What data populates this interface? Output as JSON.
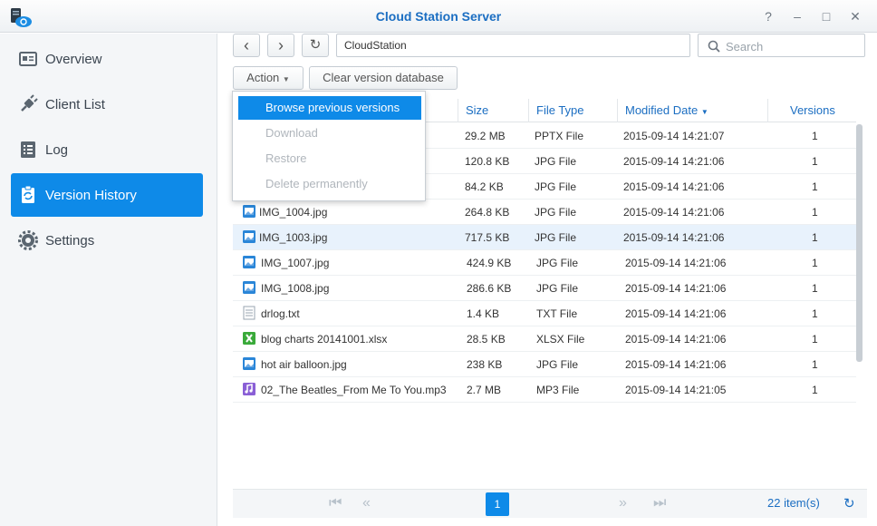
{
  "window": {
    "title": "Cloud Station Server",
    "controls": [
      "?",
      "–",
      "□",
      "✕"
    ]
  },
  "sidebar": {
    "items": [
      {
        "label": "Overview",
        "icon": "overview-icon"
      },
      {
        "label": "Client List",
        "icon": "plug-icon"
      },
      {
        "label": "Log",
        "icon": "log-icon"
      },
      {
        "label": "Version History",
        "icon": "version-history-icon",
        "active": true
      },
      {
        "label": "Settings",
        "icon": "gear-icon"
      }
    ]
  },
  "toolbar": {
    "back": "‹",
    "forward": "›",
    "refresh": "↻",
    "path": "CloudStation",
    "search_placeholder": "Search",
    "action_label": "Action",
    "clear_label": "Clear version database"
  },
  "menu": {
    "items": [
      "Browse previous versions",
      "Download",
      "Restore",
      "Delete permanently"
    ]
  },
  "table": {
    "headers": {
      "size": "Size",
      "type": "File Type",
      "modified": "Modified Date",
      "versions": "Versions"
    },
    "rows": [
      {
        "name": "",
        "size": "29.2 MB",
        "type": "PPTX File",
        "date": "2015-09-14 14:21:07",
        "versions": "1",
        "icon": "pptx"
      },
      {
        "name": "",
        "size": "120.8 KB",
        "type": "JPG File",
        "date": "2015-09-14 14:21:06",
        "versions": "1",
        "icon": "jpg"
      },
      {
        "name": "",
        "size": "84.2 KB",
        "type": "JPG File",
        "date": "2015-09-14 14:21:06",
        "versions": "1",
        "icon": "jpg"
      },
      {
        "name": "IMG_1004.jpg",
        "size": "264.8 KB",
        "type": "JPG File",
        "date": "2015-09-14 14:21:06",
        "versions": "1",
        "icon": "jpg"
      },
      {
        "name": "IMG_1003.jpg",
        "size": "717.5 KB",
        "type": "JPG File",
        "date": "2015-09-14 14:21:06",
        "versions": "1",
        "icon": "jpg",
        "selected": true
      },
      {
        "name": "IMG_1007.jpg",
        "size": "424.9 KB",
        "type": "JPG File",
        "date": "2015-09-14 14:21:06",
        "versions": "1",
        "icon": "jpg"
      },
      {
        "name": "IMG_1008.jpg",
        "size": "286.6 KB",
        "type": "JPG File",
        "date": "2015-09-14 14:21:06",
        "versions": "1",
        "icon": "jpg"
      },
      {
        "name": "drlog.txt",
        "size": "1.4 KB",
        "type": "TXT File",
        "date": "2015-09-14 14:21:06",
        "versions": "1",
        "icon": "txt"
      },
      {
        "name": "blog charts 20141001.xlsx",
        "size": "28.5 KB",
        "type": "XLSX File",
        "date": "2015-09-14 14:21:06",
        "versions": "1",
        "icon": "xlsx"
      },
      {
        "name": "hot air balloon.jpg",
        "size": "238 KB",
        "type": "JPG File",
        "date": "2015-09-14 14:21:06",
        "versions": "1",
        "icon": "jpg"
      },
      {
        "name": "02_The Beatles_From Me To You.mp3",
        "size": "2.7 MB",
        "type": "MP3 File",
        "date": "2015-09-14 14:21:05",
        "versions": "1",
        "icon": "mp3"
      }
    ]
  },
  "footer": {
    "current_page": "1",
    "count": "22 item(s)"
  },
  "colors": {
    "accent": "#0e8ae8",
    "link": "#1b6ec2"
  }
}
